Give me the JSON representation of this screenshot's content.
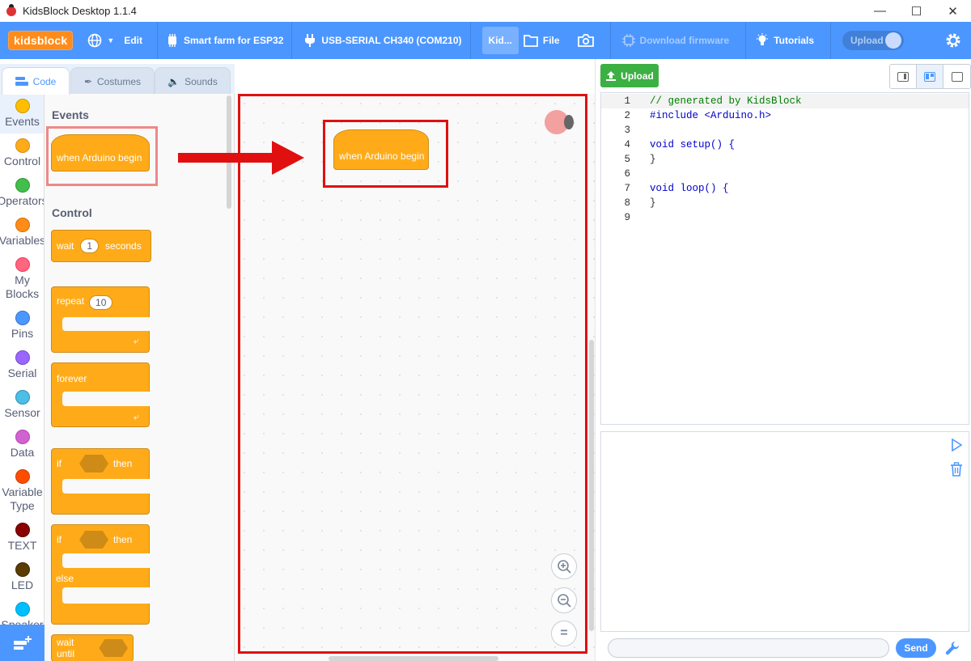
{
  "window": {
    "title": "KidsBlock Desktop 1.1.4"
  },
  "menubar": {
    "logo": "kidsblock",
    "edit": "Edit",
    "device": "Smart farm for ESP32",
    "port": "USB-SERIAL CH340 (COM210)",
    "project_tab": "Kid...",
    "file": "File",
    "download_firmware": "Download firmware",
    "tutorials": "Tutorials",
    "upload_toggle": "Upload"
  },
  "tabs": {
    "code": "Code",
    "costumes": "Costumes",
    "sounds": "Sounds"
  },
  "categories": [
    {
      "label": "Events",
      "color": "#ffbf00"
    },
    {
      "label": "Control",
      "color": "#ffab19"
    },
    {
      "label": "Operators",
      "color": "#40bf4a"
    },
    {
      "label": "Variables",
      "color": "#ff8c1a"
    },
    {
      "label": "My Blocks",
      "color": "#ff6680"
    },
    {
      "label": "Pins",
      "color": "#4c97ff"
    },
    {
      "label": "Serial",
      "color": "#9966ff"
    },
    {
      "label": "Sensor",
      "color": "#4cbfe6"
    },
    {
      "label": "Data",
      "color": "#cf63cf"
    },
    {
      "label": "Variable Type",
      "color": "#ff4d00"
    },
    {
      "label": "TEXT",
      "color": "#8b0000"
    },
    {
      "label": "LED",
      "color": "#5c3c00"
    },
    {
      "label": "Speaker",
      "color": "#00bfff"
    }
  ],
  "palette": {
    "events_title": "Events",
    "when_begin": "when Arduino begin",
    "control_title": "Control",
    "wait_label": "wait",
    "wait_value": "1",
    "wait_unit": "seconds",
    "repeat_label": "repeat",
    "repeat_value": "10",
    "forever_label": "forever",
    "if_label": "if",
    "then_label": "then",
    "else_label": "else",
    "wait_until_label": "wait until"
  },
  "workspace": {
    "hat_block": "when Arduino begin",
    "zoom_in": "+",
    "zoom_out": "−",
    "zoom_reset": "="
  },
  "right": {
    "upload_button": "Upload",
    "send_button": "Send",
    "code_lines": [
      {
        "n": "1",
        "text": "// generated by KidsBlock"
      },
      {
        "n": "2",
        "text": "#include <Arduino.h>"
      },
      {
        "n": "3",
        "text": ""
      },
      {
        "n": "4",
        "text": "void setup() {"
      },
      {
        "n": "5",
        "text": "}"
      },
      {
        "n": "6",
        "text": ""
      },
      {
        "n": "7",
        "text": "void loop() {"
      },
      {
        "n": "8",
        "text": "}"
      },
      {
        "n": "9",
        "text": ""
      }
    ]
  },
  "colors": {
    "accent": "#4c97ff",
    "control_block": "#ffab19",
    "upload_green": "#3cb043",
    "highlight_red": "#e01010"
  }
}
